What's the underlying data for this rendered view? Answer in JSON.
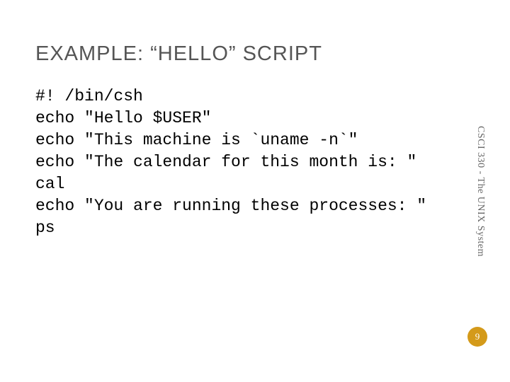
{
  "slide": {
    "title": "EXAMPLE: “HELLO” SCRIPT",
    "code": "#! /bin/csh\necho \"Hello $USER\"\necho \"This machine is `uname -n`\"\necho \"The calendar for this month is: \"\ncal\necho \"You are running these processes: \"\nps",
    "sidebar": "CSCI 330 - The UNIX System",
    "page_number": "9"
  }
}
